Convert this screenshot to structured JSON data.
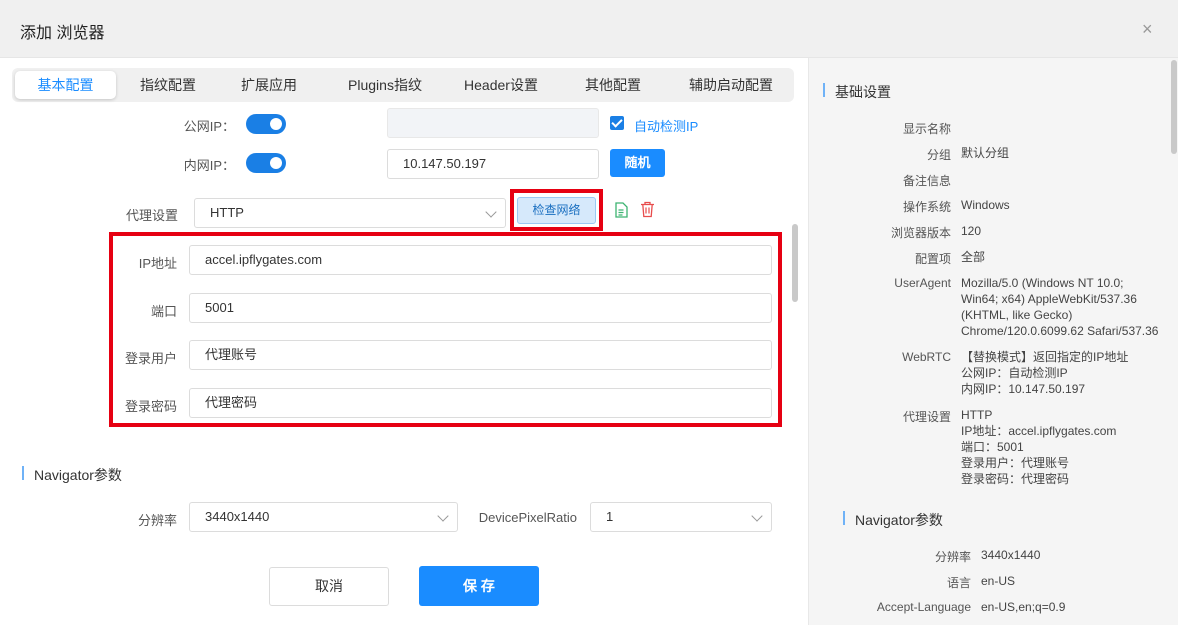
{
  "dialog": {
    "title": "添加 浏览器",
    "close": "×"
  },
  "tabs": [
    "基本配置",
    "指纹配置",
    "扩展应用",
    "Plugins指纹",
    "Header设置",
    "其他配置",
    "辅助启动配置"
  ],
  "form": {
    "public_ip_label": "公网IP：",
    "public_ip_value": "",
    "auto_detect_label": "自动检测IP",
    "private_ip_label": "内网IP：",
    "private_ip_value": "10.147.50.197",
    "random_button": "随机",
    "proxy_label": "代理设置",
    "proxy_type": "HTTP",
    "check_network_button": "检查网络",
    "ip_label": "IP地址",
    "ip_value": "accel.ipflygates.com",
    "port_label": "端口",
    "port_value": "5001",
    "user_label": "登录用户",
    "user_value": "代理账号",
    "pass_label": "登录密码",
    "pass_value": "代理密码"
  },
  "navigator": {
    "section_title": "Navigator参数",
    "resolution_label": "分辨率",
    "resolution_value": "3440x1440",
    "dpr_label": "DevicePixelRatio",
    "dpr_value": "1"
  },
  "footer": {
    "cancel": "取消",
    "save": "保 存"
  },
  "summary": {
    "basic_title": "基础设置",
    "rows": {
      "display_name": {
        "k": "显示名称",
        "v": ""
      },
      "group": {
        "k": "分组",
        "v": "默认分组"
      },
      "note": {
        "k": "备注信息",
        "v": ""
      },
      "os": {
        "k": "操作系统",
        "v": "Windows"
      },
      "browser_version": {
        "k": "浏览器版本",
        "v": "120"
      },
      "config": {
        "k": "配置项",
        "v": "全部"
      },
      "ua": {
        "k": "UserAgent",
        "v1": "Mozilla/5.0 (Windows NT 10.0;",
        "v2": "Win64; x64) AppleWebKit/537.36",
        "v3": "(KHTML, like Gecko)",
        "v4": "Chrome/120.0.6099.62 Safari/537.36"
      },
      "webrtc": {
        "k": "WebRTC",
        "v1": "【替换模式】返回指定的IP地址",
        "v2": "公网IP：自动检测IP",
        "v3": "内网IP：10.147.50.197"
      },
      "proxy": {
        "k": "代理设置",
        "v1": "HTTP",
        "v2": "IP地址：accel.ipflygates.com",
        "v3": "端口：5001",
        "v4": "登录用户：代理账号",
        "v5": "登录密码：代理密码"
      }
    },
    "nav_title": "Navigator参数",
    "nav_rows": {
      "resolution": {
        "k": "分辨率",
        "v": "3440x1440"
      },
      "language": {
        "k": "语言",
        "v": "en-US"
      },
      "accept_language": {
        "k": "Accept-Language",
        "v": "en-US,en;q=0.9"
      }
    }
  },
  "colors": {
    "accent": "#1a8cff",
    "highlight": "#e60012",
    "doc_icon": "#3cb371",
    "delete_icon": "#e84c4c"
  }
}
